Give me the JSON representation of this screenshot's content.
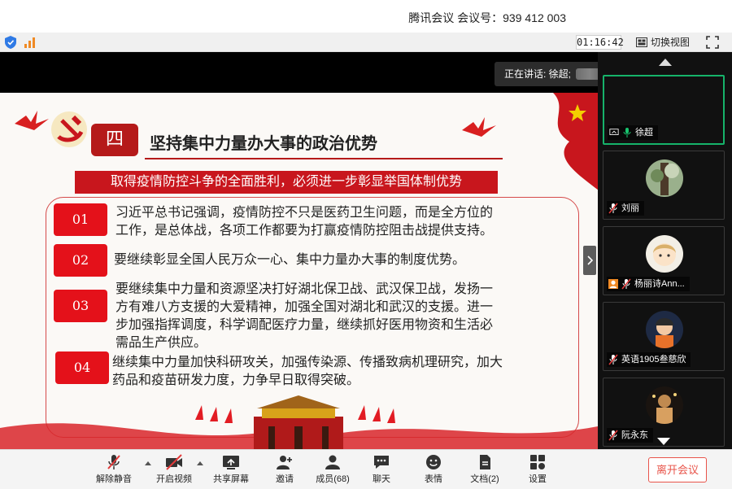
{
  "title_bar": {
    "text": "腾讯会议 会议号：939 412 003"
  },
  "toolbar": {
    "timer": "01:16:42",
    "switch_view": "切换视图"
  },
  "speaking": {
    "text": "正在讲话: 徐超;"
  },
  "slide": {
    "section_number": "四",
    "title": "坚持集中力量办大事的政治优势",
    "subtitle": "取得疫情防控斗争的全面胜利，必须进一步彰显举国体制优势",
    "items": [
      {
        "num": "01",
        "lines": [
          "习近平总书记强调，疫情防控不只是医药卫生问题，而是全方位的",
          "工作，是总体战，各项工作都要为打赢疫情防控阻击战提供支持。"
        ]
      },
      {
        "num": "02",
        "lines": [
          "要继续彰显全国人民万众一心、集中力量办大事的制度优势。"
        ]
      },
      {
        "num": "03",
        "lines": [
          "要继续集中力量和资源坚决打好湖北保卫战、武汉保卫战，发扬一",
          "方有难八方支援的大爱精神，加强全国对湖北和武汉的支援。进一",
          "步加强指挥调度，科学调配医疗力量，继续抓好医用物资和生活必",
          "需品生产供应。"
        ]
      },
      {
        "num": "04",
        "lines": [
          "继续集中力量加快科研攻关，加强传染源、传播致病机理研究，加大",
          "药品和疫苗研发力度，力争早日取得突破。"
        ]
      }
    ]
  },
  "participants": [
    {
      "name": "徐超"
    },
    {
      "name": "刘丽"
    },
    {
      "name": "杨丽诗Ann..."
    },
    {
      "name": "英语1905叁慈欣"
    },
    {
      "name": "阮永东"
    }
  ],
  "bottom_bar": {
    "unmute": "解除静音",
    "video": "开启视频",
    "share": "共享屏幕",
    "invite": "邀请",
    "members": "成员(68)",
    "chat": "聊天",
    "reaction": "表情",
    "docs": "文档(2)",
    "settings": "设置",
    "leave": "离开会议"
  }
}
